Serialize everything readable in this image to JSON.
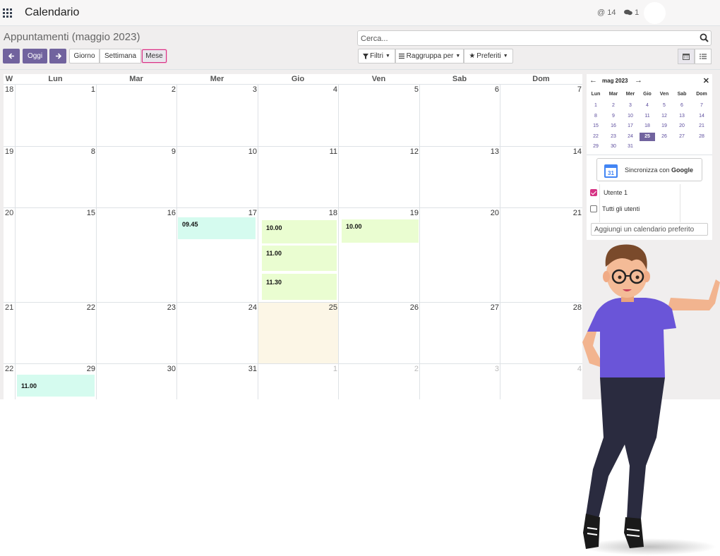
{
  "navbar": {
    "title": "Calendario",
    "mentions": "14",
    "messages": "1"
  },
  "control": {
    "title": "Appuntamenti (maggio 2023)",
    "search_placeholder": "Cerca...",
    "today": "Oggi",
    "views": {
      "day": "Giorno",
      "week": "Settimana",
      "month": "Mese"
    },
    "filters": "Filtri",
    "group_by": "Raggruppa per",
    "favorites": "Preferiti"
  },
  "calendar": {
    "week_header": "W",
    "weekdays": [
      "Lun",
      "Mar",
      "Mer",
      "Gio",
      "Ven",
      "Sab",
      "Dom"
    ],
    "weeks": [
      {
        "week": "18",
        "days": [
          "1",
          "2",
          "3",
          "4",
          "5",
          "6",
          "7"
        ]
      },
      {
        "week": "19",
        "days": [
          "8",
          "9",
          "10",
          "11",
          "12",
          "13",
          "14"
        ]
      },
      {
        "week": "20",
        "days": [
          "15",
          "16",
          "17",
          "18",
          "19",
          "20",
          "21"
        ]
      },
      {
        "week": "21",
        "days": [
          "22",
          "23",
          "24",
          "25",
          "26",
          "27",
          "28"
        ]
      },
      {
        "week": "22",
        "days": [
          "29",
          "30",
          "31",
          "1",
          "2",
          "3",
          "4"
        ]
      }
    ],
    "events": {
      "wed17": "09.45",
      "thu18_a": "10.00",
      "thu18_b": "11.00",
      "thu18_c": "11.30",
      "fri19": "10.00",
      "mon29": "11.00"
    }
  },
  "sidebar": {
    "mini_title": "mag 2023",
    "mini_weekdays": [
      "Lun",
      "Mar",
      "Mer",
      "Gio",
      "Ven",
      "Sab",
      "Dom"
    ],
    "mini_weeks": [
      [
        "1",
        "2",
        "3",
        "4",
        "5",
        "6",
        "7"
      ],
      [
        "8",
        "9",
        "10",
        "11",
        "12",
        "13",
        "14"
      ],
      [
        "15",
        "16",
        "17",
        "18",
        "19",
        "20",
        "21"
      ],
      [
        "22",
        "23",
        "24",
        "25",
        "26",
        "27",
        "28"
      ],
      [
        "29",
        "30",
        "31",
        "",
        "",
        "",
        ""
      ]
    ],
    "selected_day": "25",
    "google_icon_text": "31",
    "google_sync_prefix": "Sincronizza con ",
    "google_sync_brand": "Google",
    "filters": [
      {
        "label": "Utente 1",
        "checked": true
      },
      {
        "label": "Tutti gli utenti",
        "checked": false
      }
    ],
    "add_calendar_placeholder": "Aggiungi un calendario preferito"
  },
  "colors": {
    "primary": "#71639e",
    "event_mint": "#d5fbef",
    "event_lime": "#eafdd1",
    "today": "#fcf6e6",
    "accent_pink": "#d63384"
  }
}
